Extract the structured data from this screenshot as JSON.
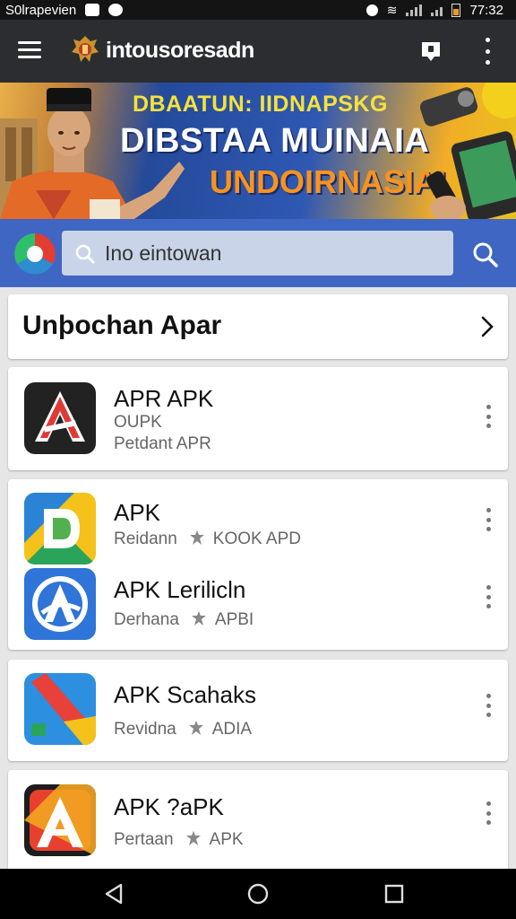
{
  "status_bar": {
    "carrier": "S0lrapevien",
    "time": "77:32"
  },
  "app_bar": {
    "title": "intousoresadn",
    "icons": [
      "menu-icon",
      "logo-emblem-icon",
      "notification-icon",
      "overflow-icon"
    ]
  },
  "banner": {
    "line1": "DBAATUN: IIDNAPSKG",
    "line2": "DIBSTAA MUINAIA",
    "line3": "UNDOIRNASIAI"
  },
  "search": {
    "placeholder": "Ino eintowan"
  },
  "section": {
    "title": "Unþochan Apar"
  },
  "apps": [
    {
      "name": "APR APK",
      "line2": "OUPK",
      "line3": "Petdant APR",
      "icon": "a-logo-red-icon"
    },
    {
      "name": "APK",
      "developer": "Reidann",
      "category": "KOOK APD",
      "icon": "d-logo-gradient-icon"
    },
    {
      "name": "APK Lerilicln",
      "developer": "Derhana",
      "category": "APBI",
      "icon": "a-logo-blue-circle-icon"
    },
    {
      "name": "APK Scahaks",
      "developer": "Revidna",
      "category": "ADIA",
      "icon": "diagonal-stripe-icon"
    },
    {
      "name": "APK ?aPK",
      "developer": "Pertaan",
      "category": "APK",
      "icon": "a-logo-orange-icon"
    }
  ],
  "nav": {
    "icons": [
      "back-icon",
      "home-icon",
      "recents-icon"
    ]
  },
  "colors": {
    "app_bar": "#2b2d31",
    "search_band": "#3f66c3",
    "background": "#e6e6e6"
  }
}
